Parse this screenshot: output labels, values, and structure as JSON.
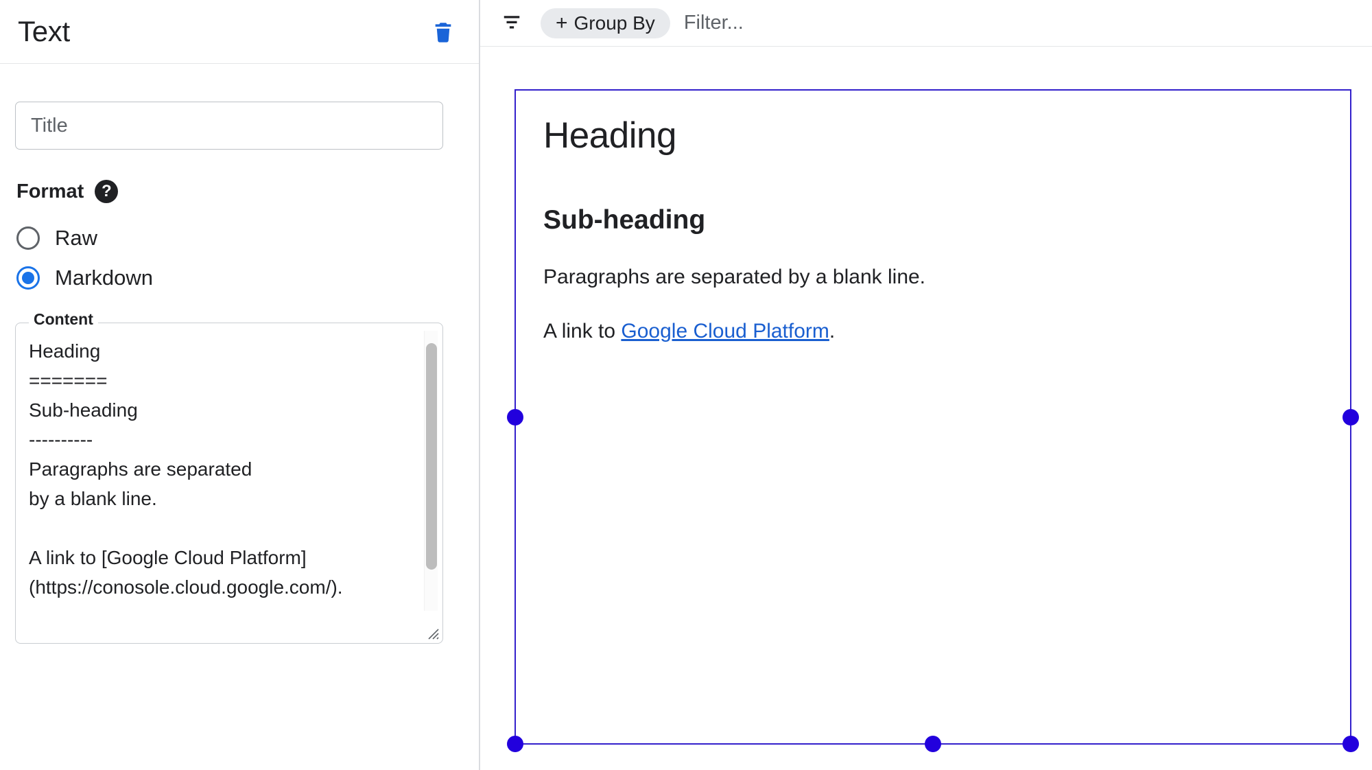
{
  "left_panel": {
    "title": "Text",
    "delete_icon": "trash-icon",
    "title_input": {
      "value": "",
      "placeholder": "Title"
    },
    "format": {
      "label": "Format",
      "help_icon": "help-icon",
      "help_glyph": "?",
      "options": [
        {
          "label": "Raw",
          "selected": false
        },
        {
          "label": "Markdown",
          "selected": true
        }
      ]
    },
    "content": {
      "legend": "Content",
      "value": "Heading\n=======\nSub-heading\n----------\nParagraphs are separated\nby a blank line.\n\nA link to [Google Cloud Platform]\n(https://conosole.cloud.google.com/).",
      "resize_handle_icon": "resize-grip-icon",
      "scrollbar_icon": "vertical-scrollbar"
    }
  },
  "toolbar": {
    "filter_icon": "filter-list-icon",
    "group_by_label": "Group By",
    "group_by_plus": "+",
    "filter_placeholder": "Filter..."
  },
  "preview": {
    "heading": "Heading",
    "sub_heading": "Sub-heading",
    "paragraph": "Paragraphs are separated by a blank line.",
    "link_prefix": "A link to ",
    "link_text": "Google Cloud Platform",
    "link_suffix": "."
  },
  "colors": {
    "accent_blue": "#1a73e8",
    "selection_border": "#3320cc",
    "handle": "#2200dd",
    "link": "#1a5fd0",
    "pill_bg": "#e8eaed"
  }
}
